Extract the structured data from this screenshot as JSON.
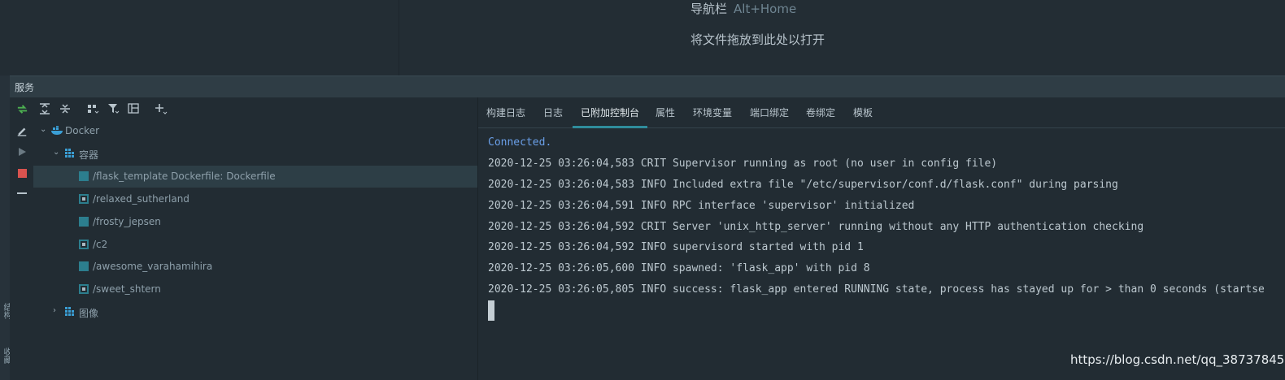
{
  "editor": {
    "nav_hint": "导航栏",
    "nav_shortcut": "Alt+Home",
    "drop_hint": "将文件拖放到此处以打开"
  },
  "services": {
    "title": "服务"
  },
  "side_labels": [
    "结构",
    "收藏"
  ],
  "tree": {
    "docker": "Docker",
    "containers": "容器",
    "items": [
      {
        "label": "/flask_template Dockerfile: Dockerfile",
        "running": false
      },
      {
        "label": "/relaxed_sutherland",
        "running": true
      },
      {
        "label": "/frosty_jepsen",
        "running": false
      },
      {
        "label": "/c2",
        "running": true
      },
      {
        "label": "/awesome_varahamihira",
        "running": false
      },
      {
        "label": "/sweet_shtern",
        "running": true
      }
    ],
    "images": "图像"
  },
  "tabs": [
    "构建日志",
    "日志",
    "已附加控制台",
    "属性",
    "环境变量",
    "端口绑定",
    "卷绑定",
    "模板"
  ],
  "active_tab": "已附加控制台",
  "console": {
    "lines": [
      "Connected.",
      "2020-12-25 03:26:04,583 CRIT Supervisor running as root (no user in config file)",
      "2020-12-25 03:26:04,583 INFO Included extra file \"/etc/supervisor/conf.d/flask.conf\" during parsing",
      "2020-12-25 03:26:04,591 INFO RPC interface 'supervisor' initialized",
      "2020-12-25 03:26:04,592 CRIT Server 'unix_http_server' running without any HTTP authentication checking",
      "2020-12-25 03:26:04,592 INFO supervisord started with pid 1",
      "2020-12-25 03:26:05,600 INFO spawned: 'flask_app' with pid 8",
      "2020-12-25 03:26:05,805 INFO success: flask_app entered RUNNING state, process has stayed up for > than 0 seconds (startse"
    ]
  },
  "watermark": "https://blog.csdn.net/qq_38737845",
  "colors": {
    "accent": "#2f8d9c",
    "container": "#2c7e8e",
    "connected": "#6a9fe8",
    "run_green": "#4caf50",
    "stop_red": "#d9534f"
  },
  "icons": [
    "refresh-icon",
    "edit-icon",
    "run-icon",
    "stop-icon",
    "minus-icon",
    "expand-all-icon",
    "collapse-all-icon",
    "group-icon",
    "filter-icon",
    "new-layout-icon",
    "add-icon",
    "docker-icon",
    "grid-icon"
  ]
}
